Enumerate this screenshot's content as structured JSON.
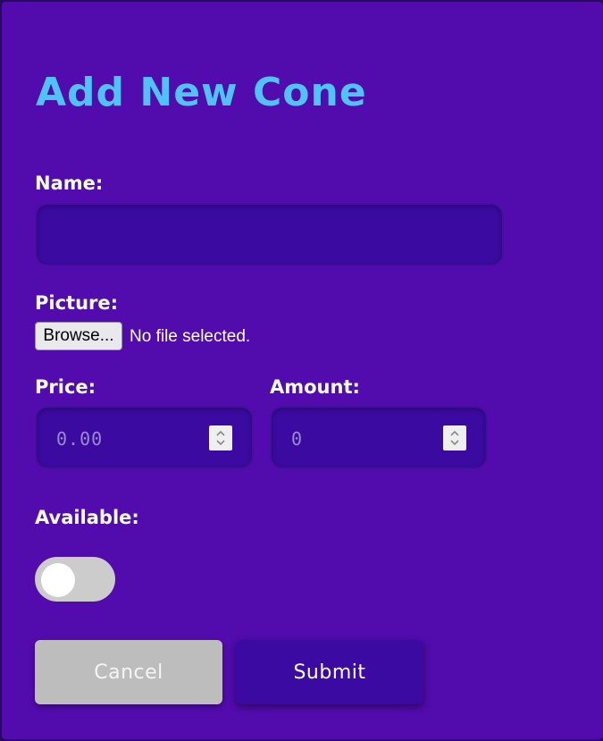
{
  "form": {
    "title": "Add New Cone",
    "name_label": "Name:",
    "name_value": "",
    "picture_label": "Picture:",
    "browse_label": "Browse...",
    "file_status": "No file selected.",
    "price_label": "Price:",
    "price_placeholder": "0.00",
    "amount_label": "Amount:",
    "amount_placeholder": "0",
    "available_label": "Available:",
    "available_on": false,
    "cancel_label": "Cancel",
    "submit_label": "Submit"
  },
  "colors": {
    "modal_bg": "#520bad",
    "title": "#4fc3f7",
    "input_bg": "#3b0aa0",
    "submit_bg": "#3a0aa3",
    "cancel_bg": "#bdbdbd",
    "toggle_off": "#cccccc"
  },
  "icons": {
    "spinner": "up-down-chevrons-icon"
  }
}
